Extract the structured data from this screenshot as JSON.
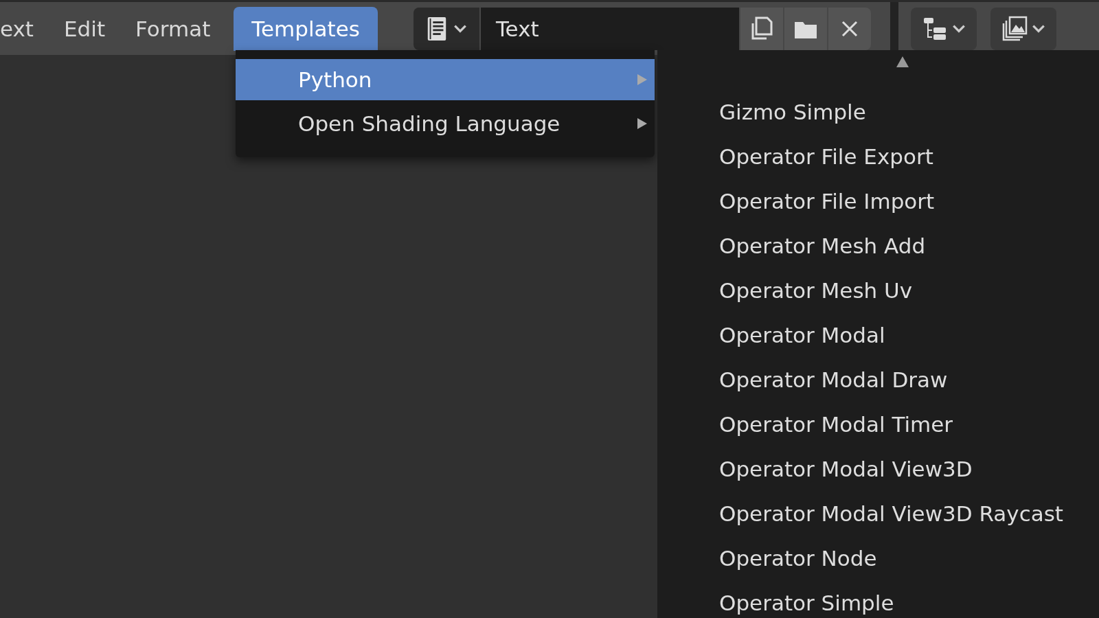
{
  "menu_bar": [
    {
      "label": "ext",
      "selected": false
    },
    {
      "label": "Edit",
      "selected": false
    },
    {
      "label": "Format",
      "selected": false
    },
    {
      "label": "Templates",
      "selected": true
    }
  ],
  "header": {
    "text_name": "Text"
  },
  "templates_menu": [
    {
      "label": "Python",
      "selected": true,
      "submenu": true
    },
    {
      "label": "Open Shading Language",
      "selected": false,
      "submenu": true
    }
  ],
  "python_submenu": {
    "scroll_up": true,
    "items": [
      {
        "label": "Gizmo Simple"
      },
      {
        "label": "Operator File Export"
      },
      {
        "label": "Operator File Import"
      },
      {
        "label": "Operator Mesh Add"
      },
      {
        "label": "Operator Mesh Uv"
      },
      {
        "label": "Operator Modal"
      },
      {
        "label": "Operator Modal Draw"
      },
      {
        "label": "Operator Modal Timer"
      },
      {
        "label": "Operator Modal View3D"
      },
      {
        "label": "Operator Modal View3D Raycast"
      },
      {
        "label": "Operator Node"
      },
      {
        "label": "Operator Simple"
      }
    ]
  }
}
